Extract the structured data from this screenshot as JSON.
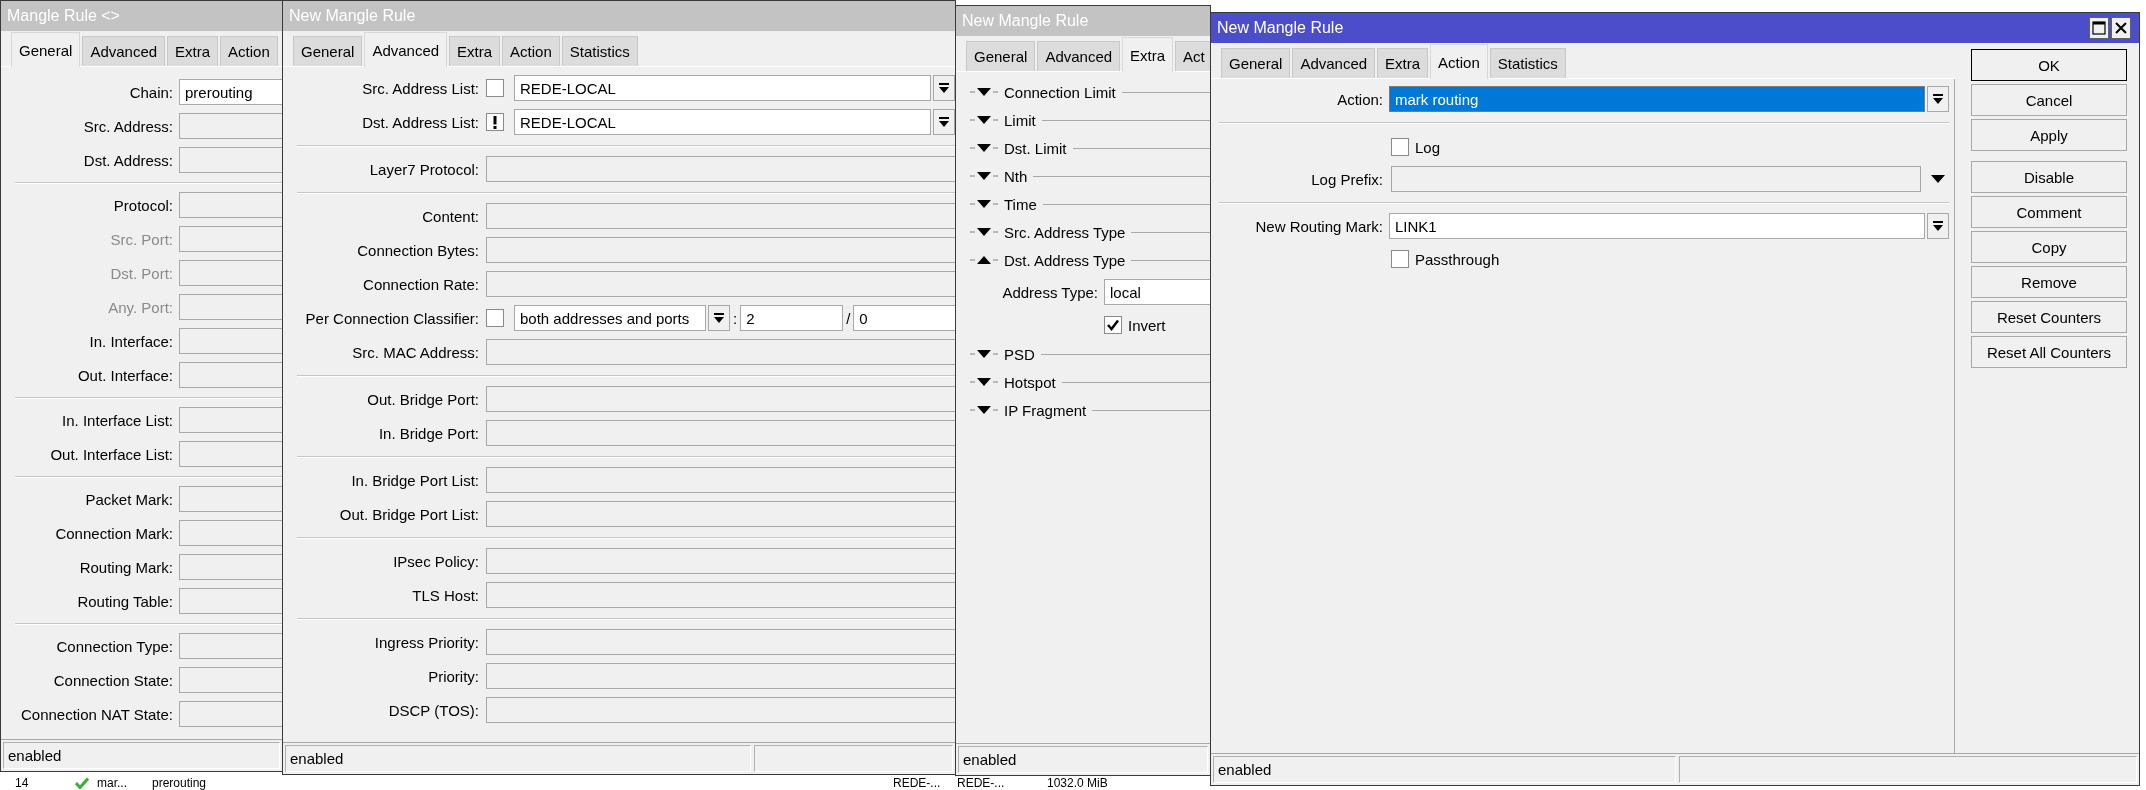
{
  "windows": [
    {
      "kind": "general",
      "title": "Mangle Rule <>",
      "active": false,
      "tabs": [
        {
          "label": "General",
          "selected": true
        },
        {
          "label": "Advanced",
          "selected": false
        },
        {
          "label": "Extra",
          "selected": false
        },
        {
          "label": "Action",
          "selected": false
        }
      ],
      "groups": [
        [
          {
            "label": "Chain:",
            "value": "prerouting",
            "disabled": false
          },
          {
            "label": "Src. Address:",
            "disabled": false
          },
          {
            "label": "Dst. Address:",
            "disabled": false
          }
        ],
        [
          {
            "label": "Protocol:",
            "disabled": false
          },
          {
            "label": "Src. Port:",
            "disabled": true
          },
          {
            "label": "Dst. Port:",
            "disabled": true
          },
          {
            "label": "Any. Port:",
            "disabled": true
          },
          {
            "label": "In. Interface:",
            "disabled": false
          },
          {
            "label": "Out. Interface:",
            "disabled": false
          }
        ],
        [
          {
            "label": "In. Interface List:",
            "disabled": false
          },
          {
            "label": "Out. Interface List:",
            "disabled": false
          }
        ],
        [
          {
            "label": "Packet Mark:",
            "disabled": false
          },
          {
            "label": "Connection Mark:",
            "disabled": false
          },
          {
            "label": "Routing Mark:",
            "disabled": false
          },
          {
            "label": "Routing Table:",
            "disabled": false
          }
        ],
        [
          {
            "label": "Connection Type:",
            "disabled": false
          },
          {
            "label": "Connection State:",
            "disabled": false
          },
          {
            "label": "Connection NAT State:",
            "disabled": false
          }
        ]
      ],
      "status": "enabled"
    },
    {
      "kind": "advanced",
      "title": "New Mangle Rule",
      "active": false,
      "tabs": [
        {
          "label": "General",
          "selected": false
        },
        {
          "label": "Advanced",
          "selected": true
        },
        {
          "label": "Extra",
          "selected": false
        },
        {
          "label": "Action",
          "selected": false
        },
        {
          "label": "Statistics",
          "selected": false
        }
      ],
      "groups": [
        [
          {
            "kind": "list",
            "label": "Src. Address List:",
            "negated": false,
            "value": "REDE-LOCAL"
          },
          {
            "kind": "list",
            "label": "Dst. Address List:",
            "negated": true,
            "value": "REDE-LOCAL"
          }
        ],
        [
          {
            "kind": "text",
            "label": "Layer7 Protocol:"
          }
        ],
        [
          {
            "kind": "text",
            "label": "Content:"
          },
          {
            "kind": "text",
            "label": "Connection Bytes:"
          },
          {
            "kind": "text",
            "label": "Connection Rate:"
          },
          {
            "kind": "classifier",
            "label": "Per Connection Classifier:",
            "negated": false,
            "value": "both addresses and ports",
            "separator": ":",
            "value_2": "2",
            "divider": "/",
            "value_3": "0"
          },
          {
            "kind": "text",
            "label": "Src. MAC Address:"
          }
        ],
        [
          {
            "kind": "text",
            "label": "Out. Bridge Port:"
          },
          {
            "kind": "text",
            "label": "In. Bridge Port:"
          }
        ],
        [
          {
            "kind": "text",
            "label": "In. Bridge Port List:"
          },
          {
            "kind": "text",
            "label": "Out. Bridge Port List:"
          }
        ],
        [
          {
            "kind": "text",
            "label": "IPsec Policy:"
          },
          {
            "kind": "text",
            "label": "TLS Host:"
          }
        ],
        [
          {
            "kind": "text",
            "label": "Ingress Priority:"
          },
          {
            "kind": "text",
            "label": "Priority:"
          },
          {
            "kind": "text",
            "label": "DSCP (TOS):"
          }
        ]
      ],
      "status": "enabled"
    },
    {
      "kind": "extra",
      "title": "New Mangle Rule",
      "active": false,
      "tabs": [
        {
          "label": "General",
          "selected": false
        },
        {
          "label": "Advanced",
          "selected": false
        },
        {
          "label": "Extra",
          "selected": true
        },
        {
          "label": "Act",
          "selected": false
        }
      ],
      "sections": [
        {
          "label": "Connection Limit",
          "expanded": false
        },
        {
          "label": "Limit",
          "expanded": false
        },
        {
          "label": "Dst. Limit",
          "expanded": false
        },
        {
          "label": "Nth",
          "expanded": false
        },
        {
          "label": "Time",
          "expanded": false
        },
        {
          "label": "Src. Address Type",
          "expanded": false
        },
        {
          "label": "Dst. Address Type",
          "expanded": true,
          "address_type": {
            "label": "Address Type:",
            "value": "local"
          },
          "invert": {
            "label": "Invert",
            "checked": true
          }
        },
        {
          "label": "PSD",
          "expanded": false
        },
        {
          "label": "Hotspot",
          "expanded": false
        },
        {
          "label": "IP Fragment",
          "expanded": false
        }
      ],
      "status": "enabled"
    },
    {
      "kind": "action",
      "title": "New Mangle Rule",
      "active": true,
      "tabs": [
        {
          "label": "General",
          "selected": false
        },
        {
          "label": "Advanced",
          "selected": false
        },
        {
          "label": "Extra",
          "selected": false
        },
        {
          "label": "Action",
          "selected": true
        },
        {
          "label": "Statistics",
          "selected": false
        }
      ],
      "action": {
        "label": "Action:",
        "value": "mark routing",
        "highlighted": true
      },
      "log": {
        "label": "Log",
        "checked": false
      },
      "log_prefix": {
        "label": "Log Prefix:"
      },
      "routing_mark": {
        "label": "New Routing Mark:",
        "value": "LINK1"
      },
      "passthrough": {
        "label": "Passthrough",
        "checked": false
      },
      "button_groups": [
        [
          {
            "label": "OK",
            "default": true
          },
          {
            "label": "Cancel",
            "default": false
          },
          {
            "label": "Apply",
            "default": false
          }
        ],
        [
          {
            "label": "Disable",
            "default": false
          },
          {
            "label": "Comment",
            "default": false
          },
          {
            "label": "Copy",
            "default": false
          },
          {
            "label": "Remove",
            "default": false
          },
          {
            "label": "Reset Counters",
            "default": false
          },
          {
            "label": "Reset All Counters",
            "default": false
          }
        ]
      ],
      "status": "enabled"
    }
  ],
  "background_row": {
    "cells": [
      "14",
      "mar...",
      "prerouting",
      "REDE-...",
      "REDE-...",
      "1032.0 MiB"
    ]
  }
}
